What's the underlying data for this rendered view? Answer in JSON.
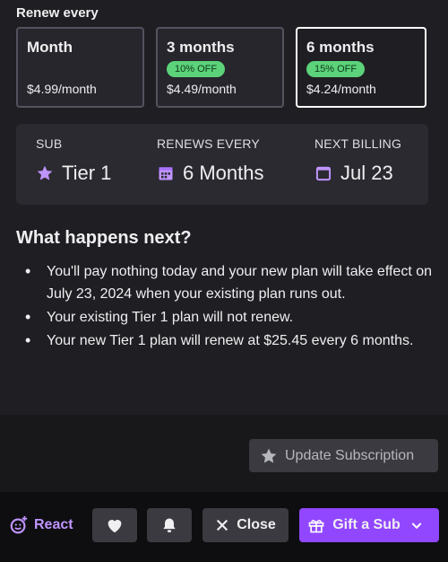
{
  "renew": {
    "header": "Renew every",
    "plans": [
      {
        "name": "Month",
        "badge": "",
        "price": "$4.99/month",
        "selected": false
      },
      {
        "name": "3 months",
        "badge": "10% OFF",
        "price": "$4.49/month",
        "selected": false
      },
      {
        "name": "6 months",
        "badge": "15% OFF",
        "price": "$4.24/month",
        "selected": true
      }
    ]
  },
  "summary": {
    "sub_label": "SUB",
    "sub_value": "Tier 1",
    "renews_label": "RENEWS EVERY",
    "renews_value": "6 Months",
    "billing_label": "NEXT BILLING",
    "billing_value": "Jul 23"
  },
  "next": {
    "title": "What happens next?",
    "bullets": [
      "You'll pay nothing today and your new plan will take effect on July 23, 2024 when your existing plan runs out.",
      "Your existing Tier 1 plan will not renew.",
      "Your new Tier 1 plan will renew at $25.45 every 6 months."
    ]
  },
  "update_button": "Update Subscription",
  "bottom": {
    "react_label": "React",
    "close_label": "Close",
    "gift_label": "Gift a Sub"
  },
  "icons": [
    "star-icon",
    "calendar-icon",
    "calendar-outline-icon",
    "heart-icon",
    "bell-icon",
    "close-icon",
    "gift-icon",
    "chevron-down-icon",
    "react-icon"
  ],
  "colors": {
    "accent": "#9147ff",
    "badge": "#5cd27a",
    "react": "#bf94ff"
  }
}
